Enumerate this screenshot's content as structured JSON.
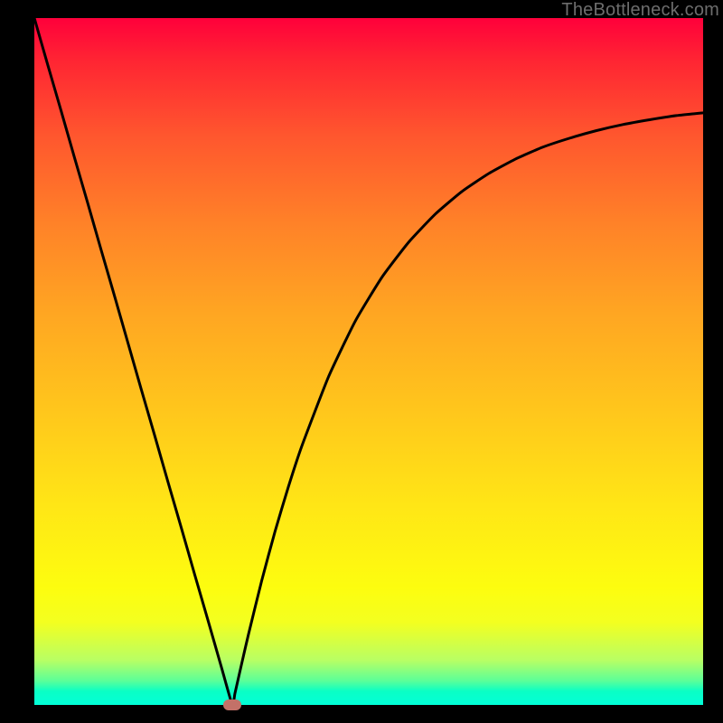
{
  "attribution": "TheBottleneck.com",
  "colors": {
    "curve_stroke": "#000000",
    "marker_fill": "#c37168",
    "frame_bg": "#000000"
  },
  "chart_data": {
    "type": "line",
    "title": "",
    "xlabel": "",
    "ylabel": "",
    "xlim": [
      0,
      100
    ],
    "ylim": [
      0,
      100
    ],
    "x": [
      0,
      2,
      4,
      6,
      8,
      10,
      12,
      14,
      16,
      18,
      20,
      22,
      24,
      26,
      28,
      29.6,
      30,
      31,
      32,
      34,
      36,
      38,
      40,
      44,
      48,
      52,
      56,
      60,
      64,
      68,
      72,
      76,
      80,
      84,
      88,
      92,
      96,
      100
    ],
    "values": [
      100,
      93.2,
      86.5,
      79.7,
      73.0,
      66.2,
      59.5,
      52.7,
      45.9,
      39.2,
      32.4,
      25.7,
      18.9,
      12.2,
      5.4,
      0.0,
      1.7,
      6.0,
      10.2,
      18.1,
      25.3,
      31.8,
      37.7,
      47.8,
      55.9,
      62.3,
      67.4,
      71.5,
      74.8,
      77.4,
      79.5,
      81.2,
      82.5,
      83.6,
      84.5,
      85.2,
      85.8,
      86.2
    ],
    "marker": {
      "x": 29.6,
      "y": 0.0
    },
    "gradient_stops": [
      {
        "pct": 0,
        "color": "#ff003b"
      },
      {
        "pct": 6,
        "color": "#ff2433"
      },
      {
        "pct": 17,
        "color": "#ff562e"
      },
      {
        "pct": 30,
        "color": "#ff8228"
      },
      {
        "pct": 43,
        "color": "#ffa622"
      },
      {
        "pct": 57,
        "color": "#ffc61c"
      },
      {
        "pct": 71,
        "color": "#ffe616"
      },
      {
        "pct": 83,
        "color": "#fdfd0f"
      },
      {
        "pct": 88,
        "color": "#f3ff20"
      },
      {
        "pct": 93.5,
        "color": "#b8ff64"
      },
      {
        "pct": 96.5,
        "color": "#5bff99"
      },
      {
        "pct": 98,
        "color": "#0affc5"
      },
      {
        "pct": 100,
        "color": "#02ffd8"
      }
    ]
  }
}
